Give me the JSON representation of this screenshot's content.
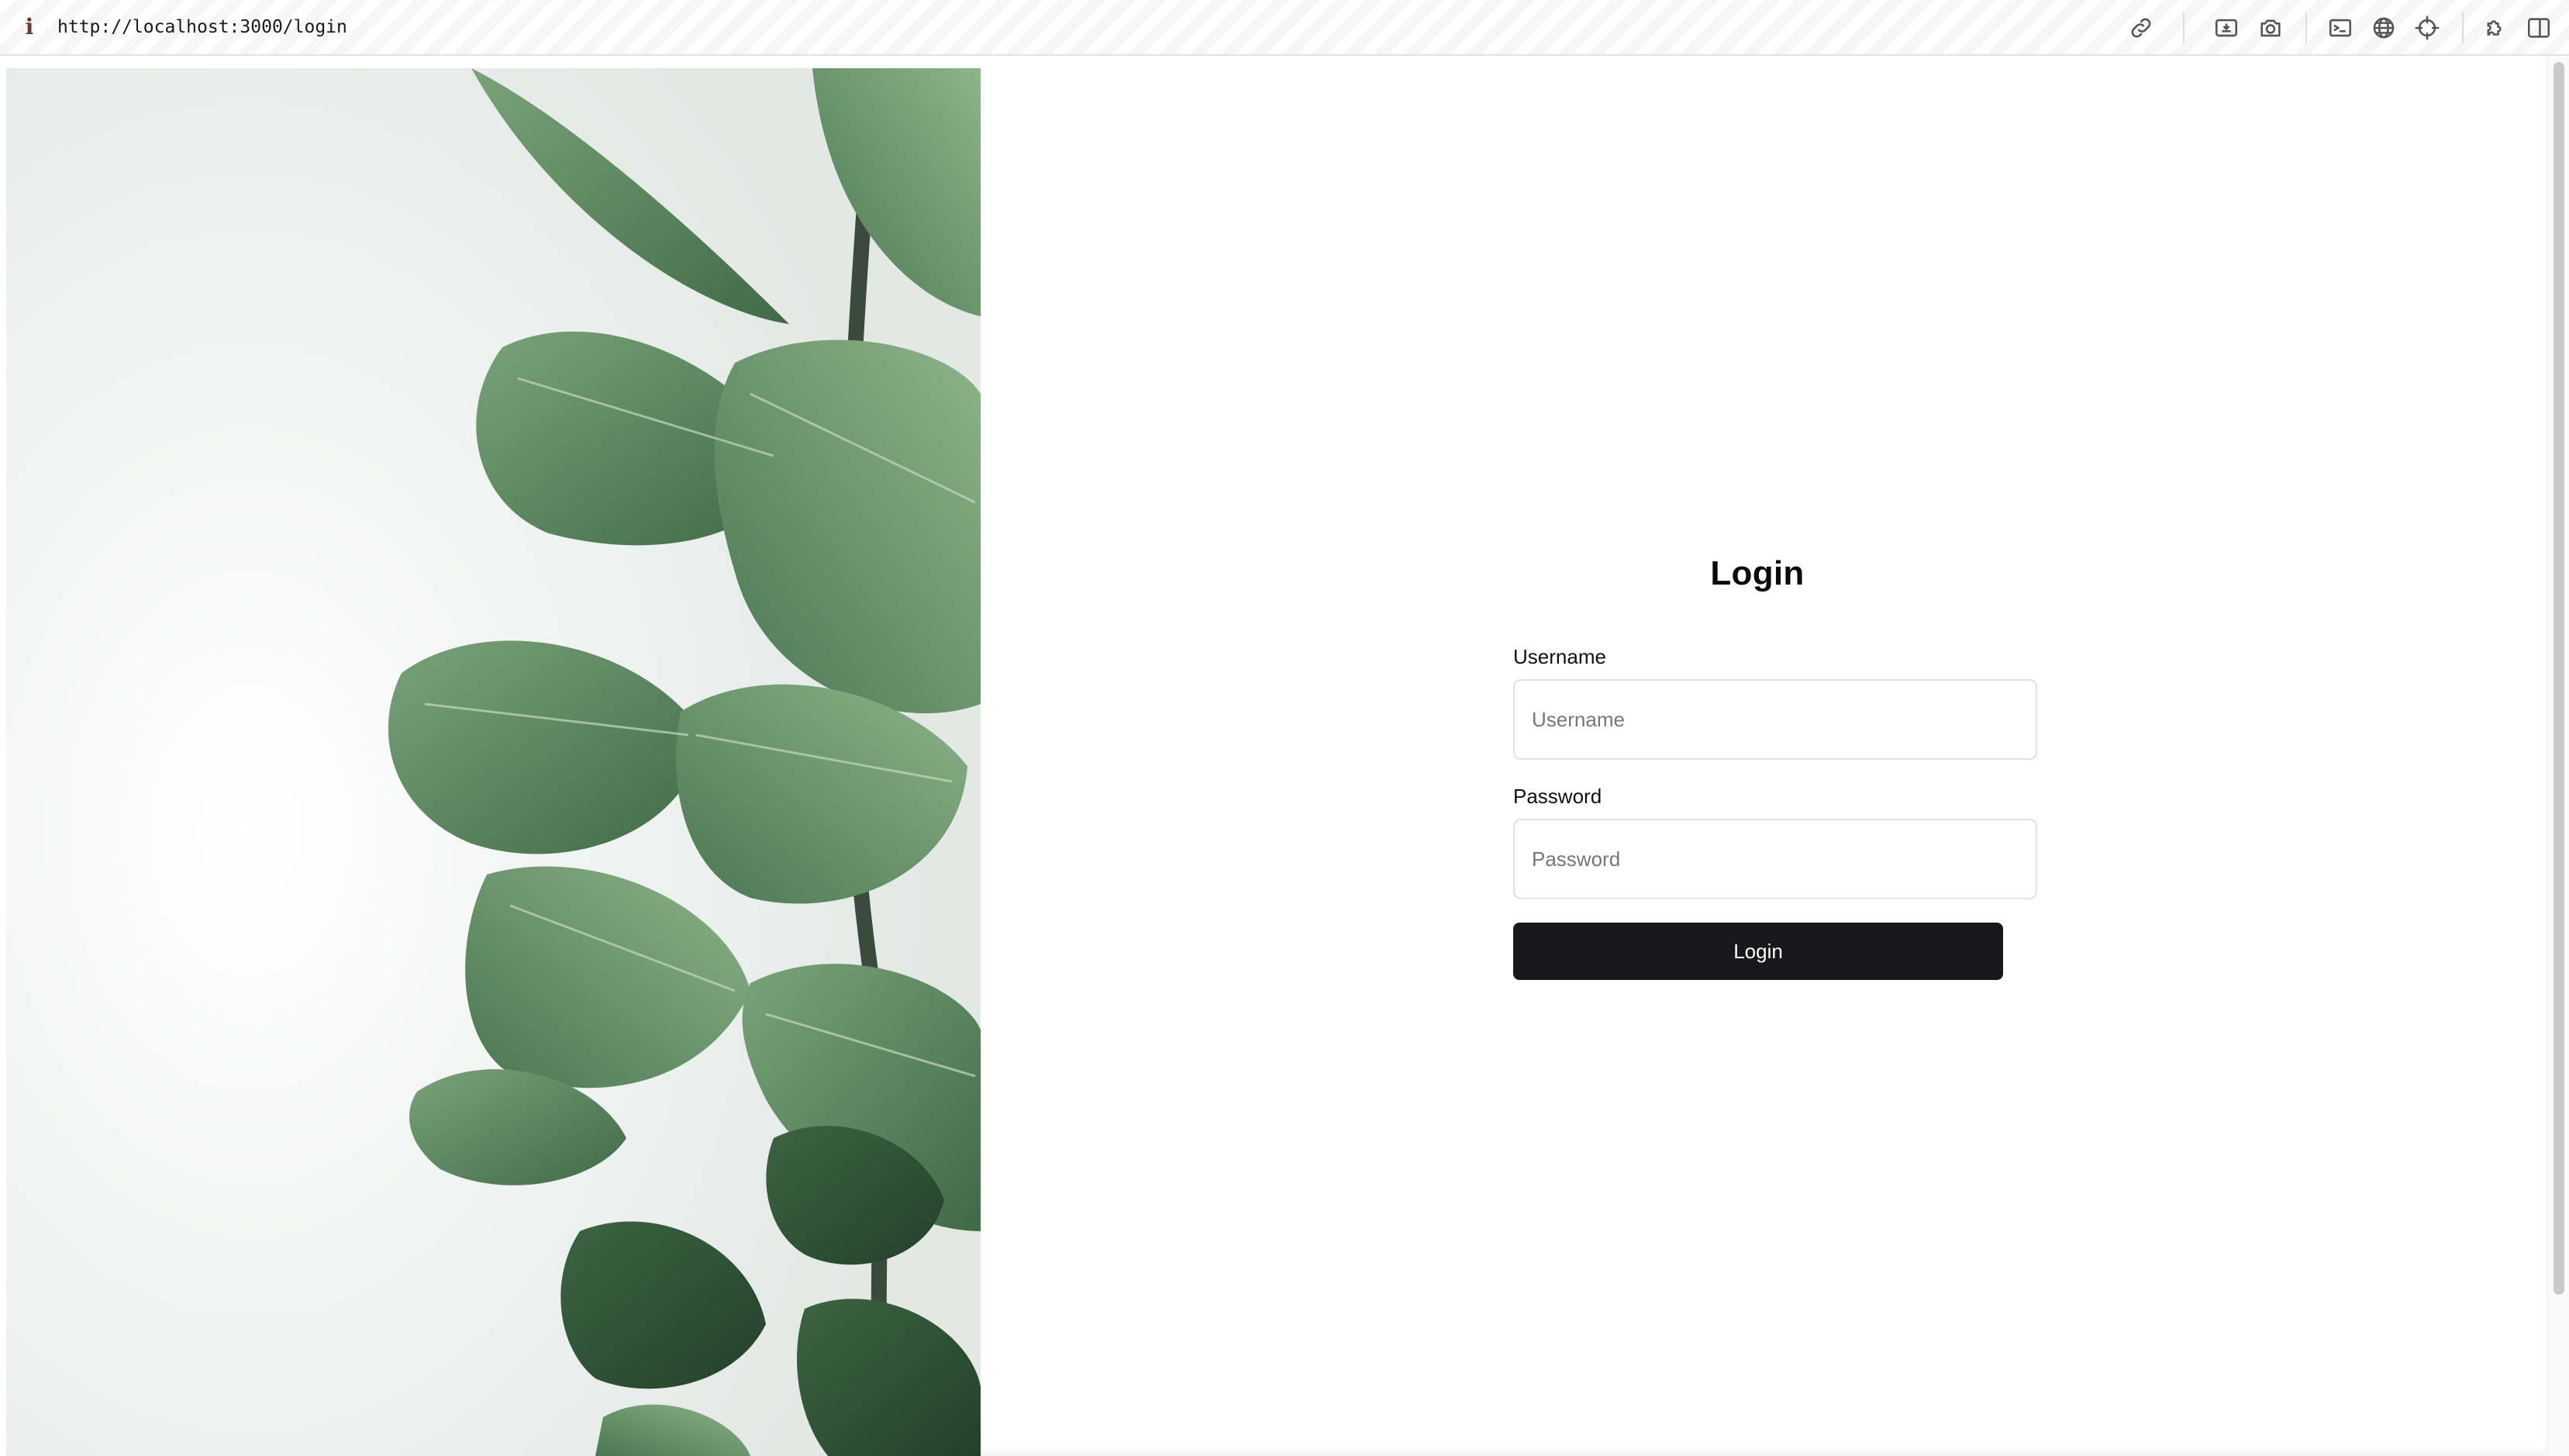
{
  "browser": {
    "url": "http://localhost:3000/login",
    "info_glyph": "i",
    "toolbar_icons": [
      "link-icon",
      "screenshot-region-icon",
      "camera-icon",
      "terminal-icon",
      "globe-icon",
      "crosshair-icon",
      "extension-icon",
      "split-view-icon"
    ]
  },
  "hero_image": {
    "subject": "fiddle-leaf fig plant against white wall",
    "colors": {
      "leaf": "#4f7a52",
      "leaf_dark": "#2f4f33",
      "leaf_light": "#7aa37a",
      "wall": "#eef0ee"
    }
  },
  "login": {
    "title": "Login",
    "username_label": "Username",
    "username_placeholder": "Username",
    "username_value": "",
    "password_label": "Password",
    "password_placeholder": "Password",
    "password_value": "",
    "submit_label": "Login"
  },
  "colors": {
    "button_bg": "#18181b",
    "button_text": "#ffffff",
    "input_border": "#e2e2e2"
  }
}
